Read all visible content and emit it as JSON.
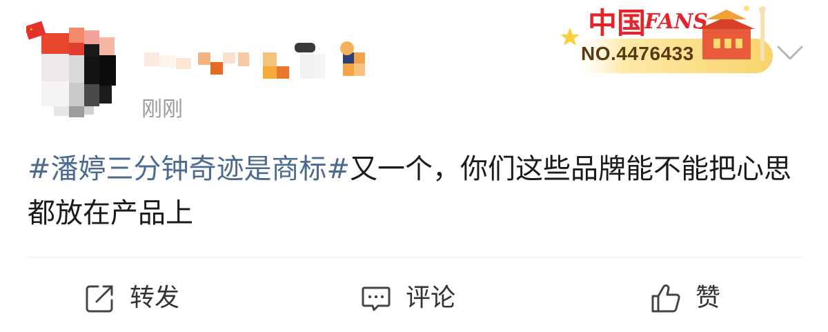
{
  "user": {
    "avatar_icon": "pixelated-avatar",
    "name_icon": "pixelated-username",
    "flag_icon": "china-flag-icon",
    "timestamp": "刚刚"
  },
  "badge": {
    "title": "中国",
    "title_en": "FANS",
    "number": "NO.4476433",
    "colors": {
      "title": "#e3262c",
      "number": "#5a3a10",
      "background": "#f9d36a"
    }
  },
  "menu": {
    "icon": "chevron-down-icon"
  },
  "post": {
    "hashtag": "#潘婷三分钟奇迹是商标#",
    "body": "又一个，你们这些品牌能不能把心思都放在产品上"
  },
  "actions": {
    "repost_label": "转发",
    "comment_label": "评论",
    "like_label": "赞"
  },
  "colors": {
    "hashtag": "#4b6a8e",
    "text": "#1a1a1a",
    "muted": "#9a9a9a"
  }
}
